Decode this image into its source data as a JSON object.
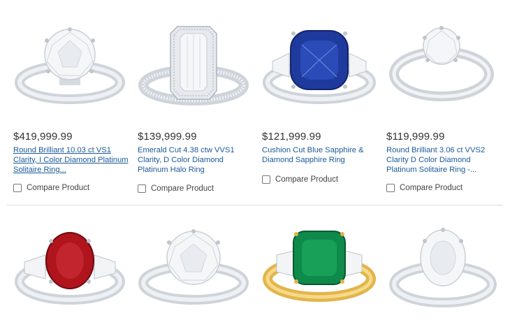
{
  "products": [
    {
      "price": "$419,999.99",
      "name": "Round Brilliant 10.03 ct VS1 Clarity, I Color Diamond Platinum Solitaire Ring...",
      "compare": "Compare Product",
      "icon": "round-diamond-solitaire-ring"
    },
    {
      "price": "$139,999.99",
      "name": "Emerald Cut 4.38 ctw VVS1 Clarity, D Color Diamond Platinum Halo Ring",
      "compare": "Compare Product",
      "icon": "emerald-cut-halo-ring"
    },
    {
      "price": "$121,999.99",
      "name": "Cushion Cut Blue Sapphire & Diamond Sapphire Ring",
      "compare": "Compare Product",
      "icon": "blue-sapphire-ring"
    },
    {
      "price": "$119,999.99",
      "name": "Round Brilliant 3.06 ct VVS2 Clarity D Color Diamond Platinum Solitaire Ring -...",
      "compare": "Compare Product",
      "icon": "round-diamond-solitaire-ring"
    }
  ],
  "products_row2": [
    {
      "icon": "ruby-three-stone-ring"
    },
    {
      "icon": "round-diamond-solitaire-ring"
    },
    {
      "icon": "emerald-gold-three-stone-ring"
    },
    {
      "icon": "oval-diamond-solitaire-ring"
    }
  ],
  "colors": {
    "link": "#1a5a9a",
    "sapphire": "#1e3a9c",
    "ruby": "#b0141c",
    "emerald": "#0e8a4a",
    "gold": "#e3b54a",
    "platinum": "#d9dde2"
  }
}
